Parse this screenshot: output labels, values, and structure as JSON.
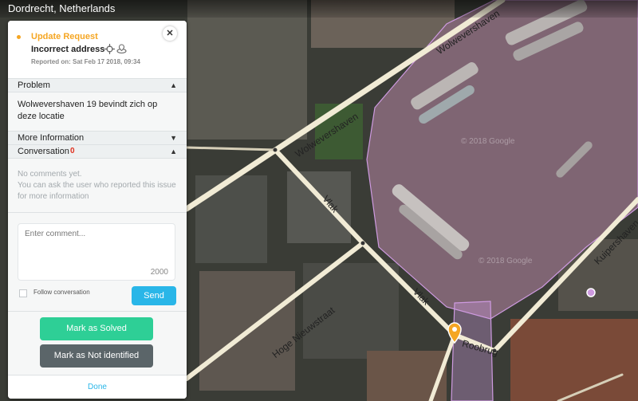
{
  "location": {
    "title": "Dordrecht, Netherlands"
  },
  "request": {
    "status_label": "Update Request",
    "status_color": "#f5a623",
    "title": "Incorrect address",
    "title_icons": [
      "crosshair-icon",
      "location-type-icon"
    ],
    "reported_on": "Reported on: Sat Feb 17 2018, 09:34"
  },
  "sections": {
    "problem": {
      "title": "Problem",
      "text": "Wolwevershaven 19 bevindt zich op deze locatie"
    },
    "more_info": {
      "title": "More Information"
    },
    "conversation": {
      "title": "Conversation",
      "count": "0",
      "empty_line1": "No comments yet.",
      "empty_line2": "You can ask the user who reported this issue for more information"
    }
  },
  "comment": {
    "placeholder": "Enter comment...",
    "char_limit": "2000",
    "follow_label": "Follow conversation",
    "follow_checked": false,
    "send_label": "Send"
  },
  "actions": {
    "solved_label": "Mark as Solved",
    "not_identified_label": "Mark as Not identified",
    "done_label": "Done"
  },
  "map": {
    "streets": [
      "Wolwevershaven",
      "Wolwevershaven",
      "Vlak",
      "Vlak",
      "Hoge Nieuwstraat",
      "Roobrug",
      "Kuipershaven"
    ],
    "watermark": "© 2018 Google",
    "highlight_color": "#ce9ae0",
    "marker_color": "#f5a623"
  }
}
